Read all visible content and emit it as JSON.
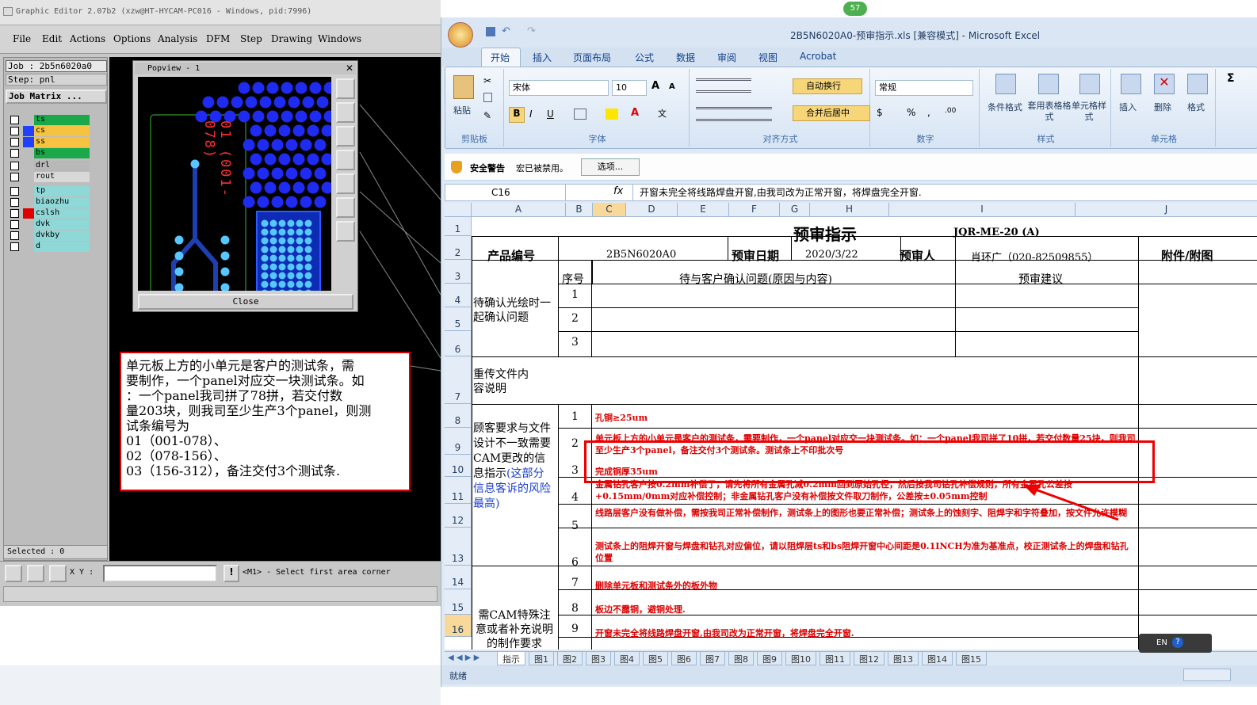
{
  "genesis": {
    "title": "Graphic Editor 2.07b2 (xzw@HT-HYCAM-PC016 - Windows, pid:7996)",
    "menu": [
      "File",
      "Edit",
      "Actions",
      "Options",
      "Analysis",
      "DFM",
      "Step",
      "Drawing",
      "Windows"
    ],
    "job_label": "Job : 2b5n6020a0",
    "step_label": "Step: pnl",
    "job_matrix_label": "Job Matrix ...",
    "layers": [
      {
        "name": "ts",
        "color": "#1aa84a"
      },
      {
        "name": "cs",
        "color": "#f5c242"
      },
      {
        "name": "ss",
        "color": "#f5c242"
      },
      {
        "name": "bs",
        "color": "#1aa84a"
      },
      {
        "name": "drl",
        "color": "#b8b8b8"
      },
      {
        "name": "rout",
        "color": "#d8d8d8"
      },
      {
        "name": "tp",
        "color": "#8fd8d8"
      },
      {
        "name": "biaozhu",
        "color": "#8fd8d8"
      },
      {
        "name": "cslsh",
        "color": "#8fd8d8"
      },
      {
        "name": "dvk",
        "color": "#8fd8d8"
      },
      {
        "name": "dvkby",
        "color": "#8fd8d8"
      },
      {
        "name": "d",
        "color": "#8fd8d8"
      }
    ],
    "selected_label": "Selected : 0",
    "xy_label": "X Y :",
    "xy_value": "",
    "prompt": "<M1> - Select first area corner",
    "popview": {
      "title": "Popview - 1",
      "close_label": "Close",
      "coupon_label": "01 (001-078)"
    },
    "note_lines": [
      "单元板上方的小单元是客户的测试条，需",
      "要制作，一个panel对应交一块测试条。如",
      "：一个panel我司拼了78拼，若交付数",
      "量203块，则我司至少生产3个panel，则测",
      "试条编号为",
      "01（001-078）、",
      "02（078-156）、",
      "03（156-312），备注交付3个测试条."
    ]
  },
  "excel": {
    "title": "2B5N6020A0-预审指示.xls  [兼容模式] - Microsoft Excel",
    "tabs": [
      "开始",
      "插入",
      "页面布局",
      "公式",
      "数据",
      "审阅",
      "视图",
      "Acrobat"
    ],
    "ribbon": {
      "paste": "粘贴",
      "clipboard": "剪贴板",
      "font_name": "宋体",
      "font_size": "10",
      "font_group": "字体",
      "wrap": "自动换行",
      "merge": "合并后居中",
      "align_group": "对齐方式",
      "number_format": "常规",
      "number_group": "数字",
      "cond_format": "条件格式",
      "table_format": "套用表格格式",
      "cell_style": "单元格样式",
      "styles_group": "样式",
      "insert": "插入",
      "delete": "删除",
      "format": "格式",
      "cells_group": "单元格"
    },
    "security": {
      "label": "安全警告",
      "message": "宏已被禁用。",
      "options": "选项..."
    },
    "name_box": "C16",
    "formula": "开窗未完全将线路焊盘开窗,由我司改为正常开窗，将焊盘完全开窗.",
    "columns": [
      "A",
      "B",
      "C",
      "D",
      "E",
      "F",
      "G",
      "H",
      "I",
      "J"
    ],
    "rows": [
      "1",
      "2",
      "3",
      "4",
      "5",
      "6",
      "7",
      "8",
      "9",
      "10",
      "11",
      "12",
      "13",
      "14",
      "15",
      "16"
    ],
    "sheet": {
      "title": "预审指示",
      "code": "JQR-ME-20 (A)",
      "product_label": "产品编号",
      "product_value": "2B5N6020A0",
      "date_label": "预审日期",
      "date_value": "2020/3/22",
      "reviewer_label": "预审人",
      "reviewer_value": "肖环广（020-82509855）",
      "attach_label": "附件/附图",
      "seq_label": "序号",
      "issue_label": "待与客户确认问题(原因与内容)",
      "suggest_label": "预审建议",
      "group1": "待确认光绘时一起确认问题",
      "group2": "重传文件内容说明",
      "group3_a": "顾客要求与文件设计不一致需要CAM更改的信息指示",
      "group3_b": "(这部分信息客诉的风险最高)",
      "group4": "需CAM特殊注意或者补充说明的制作要求",
      "items": [
        "孔铜≥25um",
        "单元板上方的小单元是客户的测试条，需要制作，一个panel对应交一块测试条。如：一个panel我司拼了10拼，若交付数量25块，则我司至少生产3个panel，备注交付3个测试条。测试条上不印批次号",
        "完成铜厚35um",
        "金属钻孔客户按0.2mm补偿了，请先将所有金属孔减0.2mm回到原始孔径，然后按我司钻孔补偿规则，所有金属孔公差按+0.15mm/0mm对应补偿控制；非金属钻孔客户没有补偿按文件取刀制作，公差按±0.05mm控制",
        "线路层客户没有做补偿，需按我司正常补偿制作，测试条上的图形也要正常补偿；测试条上的蚀刻字、阻焊字和字符叠加，按文件允许模糊",
        "测试条上的阻焊开窗与焊盘和钻孔对应偏位，请以阻焊层ts和bs阻焊开窗中心间距是0.1INCH为准为基准点，校正测试条上的焊盘和钻孔位置",
        "删除单元板和测试条外的板外物",
        "板边不露铜，避铜处理.",
        "开窗未完全将线路焊盘开窗,由我司改为正常开窗，将焊盘完全开窗."
      ],
      "seq_top": [
        "1",
        "2",
        "3"
      ],
      "seq_bottom": [
        "1",
        "2",
        "3",
        "4",
        "5",
        "6",
        "7",
        "8",
        "9"
      ]
    },
    "sheet_tabs": [
      "指示",
      "图1",
      "图2",
      "图3",
      "图4",
      "图5",
      "图6",
      "图7",
      "图8",
      "图9",
      "图10",
      "图11",
      "图12",
      "图13",
      "图14",
      "图15"
    ],
    "status": "就绪",
    "lang": "EN",
    "badge": "57"
  }
}
